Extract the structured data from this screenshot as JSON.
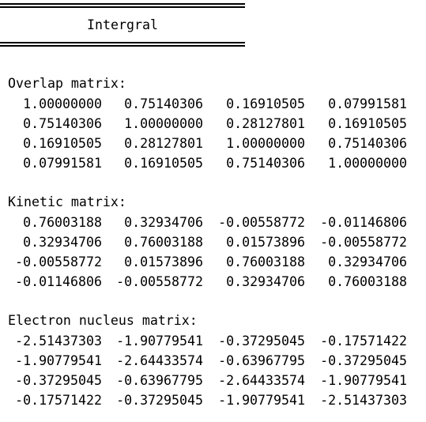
{
  "header": {
    "title": "Intergral"
  },
  "sections": [
    {
      "label": "Overlap matrix:",
      "rows": [
        [
          "1.00000000",
          "0.75140306",
          "0.16910505",
          "0.07991581"
        ],
        [
          "0.75140306",
          "1.00000000",
          "0.28127801",
          "0.16910505"
        ],
        [
          "0.16910505",
          "0.28127801",
          "1.00000000",
          "0.75140306"
        ],
        [
          "0.07991581",
          "0.16910505",
          "0.75140306",
          "1.00000000"
        ]
      ]
    },
    {
      "label": "Kinetic matrix:",
      "rows": [
        [
          "0.76003188",
          "0.32934706",
          "-0.00558772",
          "-0.01146806"
        ],
        [
          "0.32934706",
          "0.76003188",
          "0.01573896",
          "-0.00558772"
        ],
        [
          "-0.00558772",
          "0.01573896",
          "0.76003188",
          "0.32934706"
        ],
        [
          "-0.01146806",
          "-0.00558772",
          "0.32934706",
          "0.76003188"
        ]
      ]
    },
    {
      "label": "Electron nucleus matrix:",
      "rows": [
        [
          "-2.51437303",
          "-1.90779541",
          "-0.37295045",
          "-0.17571422"
        ],
        [
          "-1.90779541",
          "-2.64433574",
          "-0.63967795",
          "-0.37295045"
        ],
        [
          "-0.37295045",
          "-0.63967795",
          "-2.64433574",
          "-1.90779541"
        ],
        [
          "-0.17571422",
          "-0.37295045",
          "-1.90779541",
          "-2.51437303"
        ]
      ]
    }
  ]
}
